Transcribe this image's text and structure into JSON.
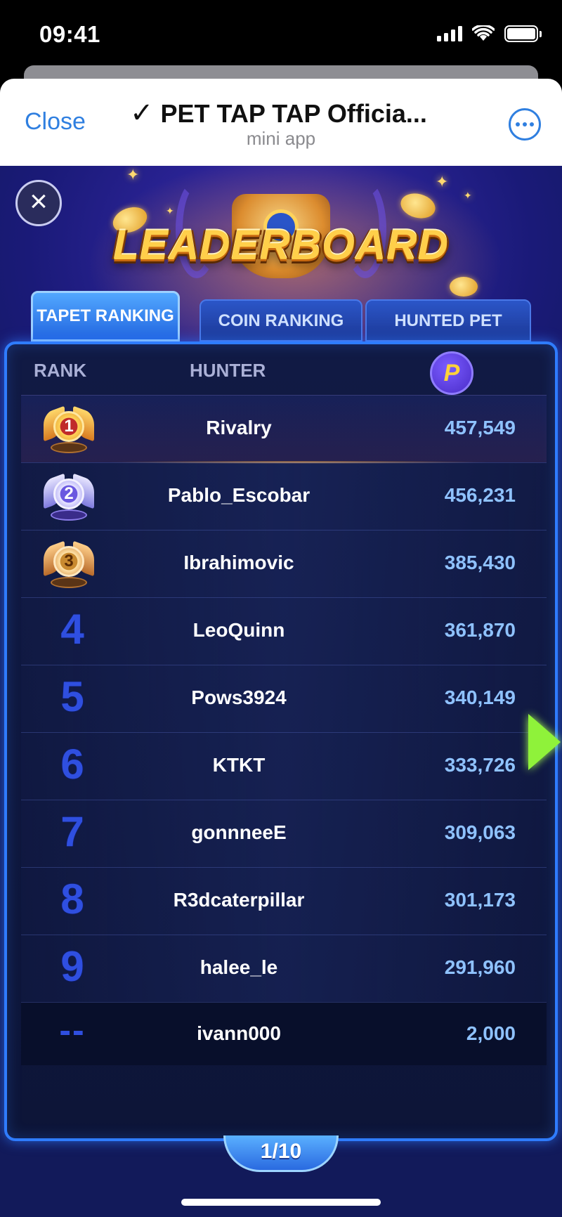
{
  "status_bar": {
    "time": "09:41"
  },
  "telegram_header": {
    "close_label": "Close",
    "title": "PET TAP TAP Officia...",
    "check_glyph": "✓",
    "subtitle": "mini app",
    "more_icon": "ellipsis-circle-icon"
  },
  "game": {
    "close_glyph": "×",
    "title": "LEADERBOARD",
    "tabs": [
      {
        "label": "TAPET RANKING",
        "active": true
      },
      {
        "label": "COIN RANKING",
        "active": false
      },
      {
        "label": "HUNTED PET",
        "active": false
      }
    ],
    "columns": {
      "rank": "RANK",
      "hunter": "HUNTER",
      "score_icon": "pet-token-icon",
      "score_glyph": "P"
    },
    "rows": [
      {
        "rank": "1",
        "name": "Rivalry",
        "score": "457,549"
      },
      {
        "rank": "2",
        "name": "Pablo_Escobar",
        "score": "456,231"
      },
      {
        "rank": "3",
        "name": "Ibrahimovic",
        "score": "385,430"
      },
      {
        "rank": "4",
        "name": "LeoQuinn",
        "score": "361,870"
      },
      {
        "rank": "5",
        "name": "Pows3924",
        "score": "340,149"
      },
      {
        "rank": "6",
        "name": "KTKT",
        "score": "333,726"
      },
      {
        "rank": "7",
        "name": "gonnneeE",
        "score": "309,063"
      },
      {
        "rank": "8",
        "name": "R3dcaterpillar",
        "score": "301,173"
      },
      {
        "rank": "9",
        "name": "halee_le",
        "score": "291,960"
      }
    ],
    "self_row": {
      "rank": "--",
      "name": "ivann000",
      "score": "2,000"
    },
    "pager": "1/10",
    "colors": {
      "accent": "#2f7cff",
      "rank_number": "#2f4fe0",
      "score": "#8fc2ff",
      "title": "#ffcf4a"
    }
  }
}
